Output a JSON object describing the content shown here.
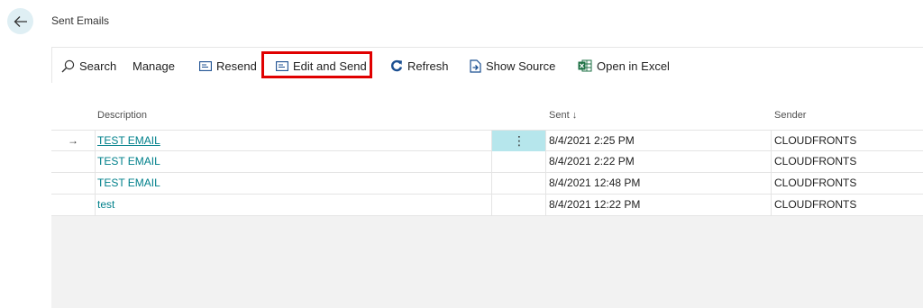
{
  "page": {
    "title": "Sent Emails"
  },
  "actions": {
    "search": "Search",
    "manage": "Manage",
    "resend": "Resend",
    "edit_and_send": "Edit and Send",
    "refresh": "Refresh",
    "show_source": "Show Source",
    "open_in_excel": "Open in Excel"
  },
  "icons": {
    "back": "arrow-left-icon",
    "search": "search-icon",
    "resend": "mail-card-icon",
    "edit_and_send": "mail-card-icon",
    "refresh": "refresh-icon",
    "show_source": "document-arrow-icon",
    "excel": "excel-icon",
    "row_indicator": "arrow-right-icon",
    "row_menu": "more-vertical-icon"
  },
  "colors": {
    "accent": "#00808b",
    "highlight": "#e00000",
    "selected_cell": "#b6e6ec",
    "refresh_icon": "#1b4f91",
    "excel_icon": "#1e7145"
  },
  "grid": {
    "columns": {
      "description": "Description",
      "sent": "Sent",
      "sort_indicator": "↓",
      "sender": "Sender"
    },
    "rows": [
      {
        "indicator": "→",
        "menu": "⋮",
        "description": "TEST EMAIL",
        "sent": "8/4/2021 2:25 PM",
        "sender": "CLOUDFRONTS"
      },
      {
        "description": "TEST EMAIL",
        "sent": "8/4/2021 2:22 PM",
        "sender": "CLOUDFRONTS"
      },
      {
        "description": "TEST EMAIL",
        "sent": "8/4/2021 12:48 PM",
        "sender": "CLOUDFRONTS"
      },
      {
        "description": "test",
        "sent": "8/4/2021 12:22 PM",
        "sender": "CLOUDFRONTS"
      }
    ]
  }
}
